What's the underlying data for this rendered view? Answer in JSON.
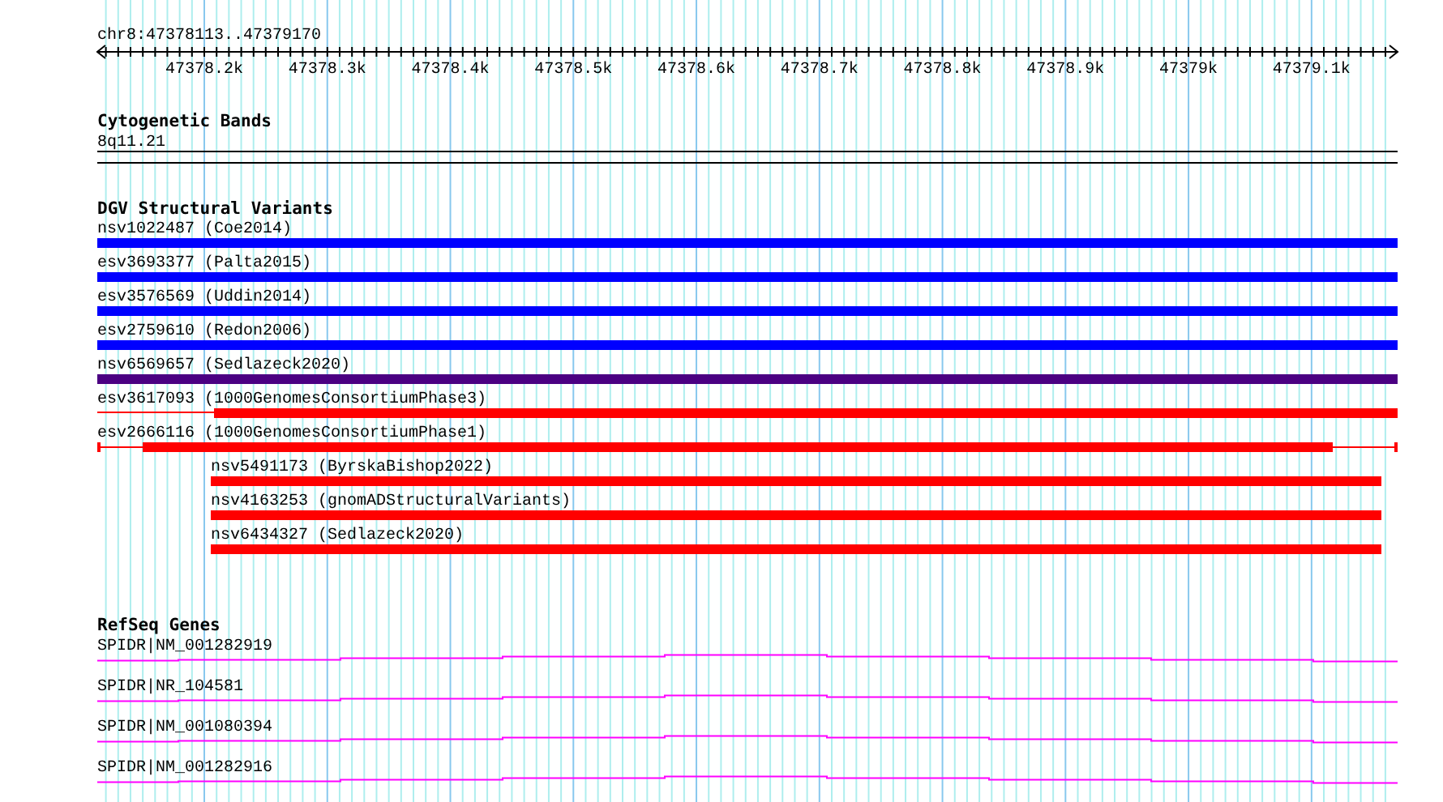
{
  "ruler": {
    "position": "chr8:47378113..47379170",
    "tick_labels": [
      "47378.2k",
      "47378.3k",
      "47378.4k",
      "47378.5k",
      "47378.6k",
      "47378.7k",
      "47378.8k",
      "47378.9k",
      "47379k",
      "47379.1k"
    ]
  },
  "cytogenetic_bands": {
    "title": "Cytogenetic Bands",
    "band": "8q11.21"
  },
  "dgv_structural_variants": {
    "title": "DGV Structural Variants",
    "items": [
      {
        "label": "nsv1022487 (Coe2014)",
        "kind": "full",
        "color": "#0000ff"
      },
      {
        "label": "esv3693377 (Palta2015)",
        "kind": "full",
        "color": "#0000ff"
      },
      {
        "label": "esv3576569 (Uddin2014)",
        "kind": "full",
        "color": "#0000ff"
      },
      {
        "label": "esv2759610 (Redon2006)",
        "kind": "full",
        "color": "#0000ff"
      },
      {
        "label": "nsv6569657 (Sedlazeck2020)",
        "kind": "full",
        "color": "#4b0082"
      },
      {
        "label": "esv3617093 (1000GenomesConsortiumPhase3)",
        "kind": "thin-left",
        "color": "#ff0000"
      },
      {
        "label": "esv2666116 (1000GenomesConsortiumPhase1)",
        "kind": "thin-ends",
        "color": "#ff0000"
      },
      {
        "label": "nsv5491173 (ByrskaBishop2022)",
        "kind": "inset",
        "color": "#ff0000"
      },
      {
        "label": "nsv4163253 (gnomADStructuralVariants)",
        "kind": "inset",
        "color": "#ff0000"
      },
      {
        "label": "nsv6434327 (Sedlazeck2020)",
        "kind": "inset",
        "color": "#ff0000"
      }
    ]
  },
  "refseq_genes": {
    "title": "RefSeq Genes",
    "items": [
      {
        "label": "SPIDR|NM_001282919"
      },
      {
        "label": "SPIDR|NR_104581"
      },
      {
        "label": "SPIDR|NM_001080394"
      },
      {
        "label": "SPIDR|NM_001282916"
      }
    ]
  }
}
